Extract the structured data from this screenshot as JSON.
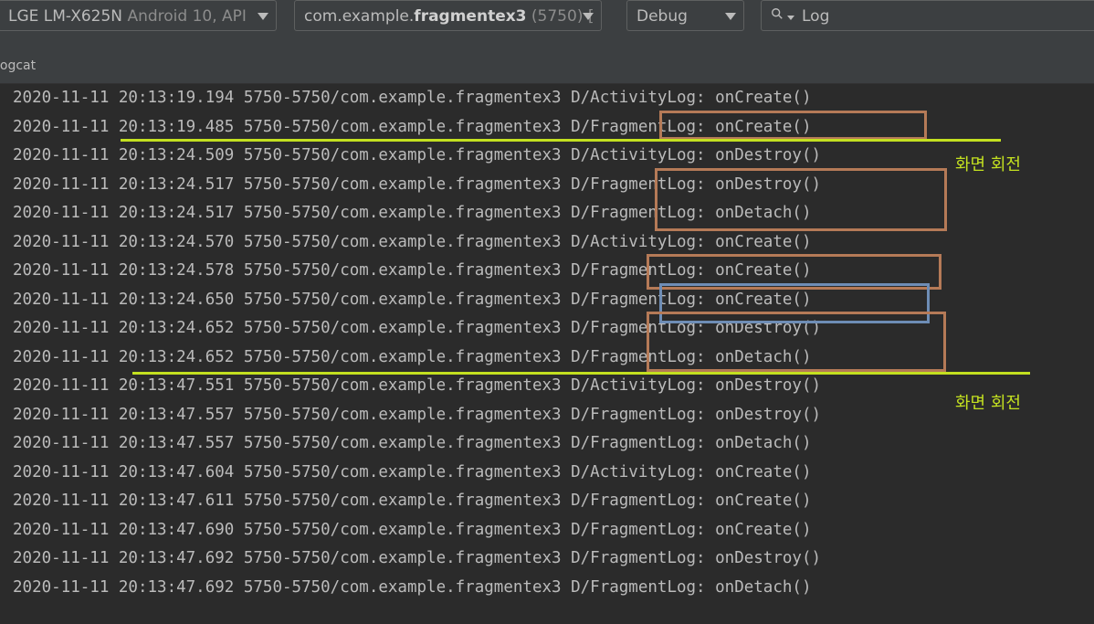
{
  "toolbar": {
    "device_name": "LGE LM-X625N",
    "device_info": "Android 10, API",
    "process_prefix": "com.example.",
    "process_bold": "fragmentex3",
    "process_suffix": " (5750) [",
    "log_level": "Debug",
    "search_value": "Log"
  },
  "panel": {
    "title": "logcat"
  },
  "log_lines": [
    "2020-11-11 20:13:19.194 5750-5750/com.example.fragmentex3 D/ActivityLog: onCreate()",
    "2020-11-11 20:13:19.485 5750-5750/com.example.fragmentex3 D/FragmentLog: onCreate()",
    "2020-11-11 20:13:24.509 5750-5750/com.example.fragmentex3 D/ActivityLog: onDestroy()",
    "2020-11-11 20:13:24.517 5750-5750/com.example.fragmentex3 D/FragmentLog: onDestroy()",
    "2020-11-11 20:13:24.517 5750-5750/com.example.fragmentex3 D/FragmentLog: onDetach()",
    "2020-11-11 20:13:24.570 5750-5750/com.example.fragmentex3 D/ActivityLog: onCreate()",
    "2020-11-11 20:13:24.578 5750-5750/com.example.fragmentex3 D/FragmentLog: onCreate()",
    "2020-11-11 20:13:24.650 5750-5750/com.example.fragmentex3 D/FragmentLog: onCreate()",
    "2020-11-11 20:13:24.652 5750-5750/com.example.fragmentex3 D/FragmentLog: onDestroy()",
    "2020-11-11 20:13:24.652 5750-5750/com.example.fragmentex3 D/FragmentLog: onDetach()",
    "2020-11-11 20:13:47.551 5750-5750/com.example.fragmentex3 D/ActivityLog: onDestroy()",
    "2020-11-11 20:13:47.557 5750-5750/com.example.fragmentex3 D/FragmentLog: onDestroy()",
    "2020-11-11 20:13:47.557 5750-5750/com.example.fragmentex3 D/FragmentLog: onDetach()",
    "2020-11-11 20:13:47.604 5750-5750/com.example.fragmentex3 D/ActivityLog: onCreate()",
    "2020-11-11 20:13:47.611 5750-5750/com.example.fragmentex3 D/FragmentLog: onCreate()",
    "2020-11-11 20:13:47.690 5750-5750/com.example.fragmentex3 D/FragmentLog: onCreate()",
    "2020-11-11 20:13:47.692 5750-5750/com.example.fragmentex3 D/FragmentLog: onDestroy()",
    "2020-11-11 20:13:47.692 5750-5750/com.example.fragmentex3 D/FragmentLog: onDetach()"
  ],
  "annotations": {
    "note_1": "화면 회전",
    "note_2": "화면 회전",
    "box_color": "#b57a57",
    "box_highlight_color": "#6e8db6",
    "line_color": "#c3e020"
  }
}
